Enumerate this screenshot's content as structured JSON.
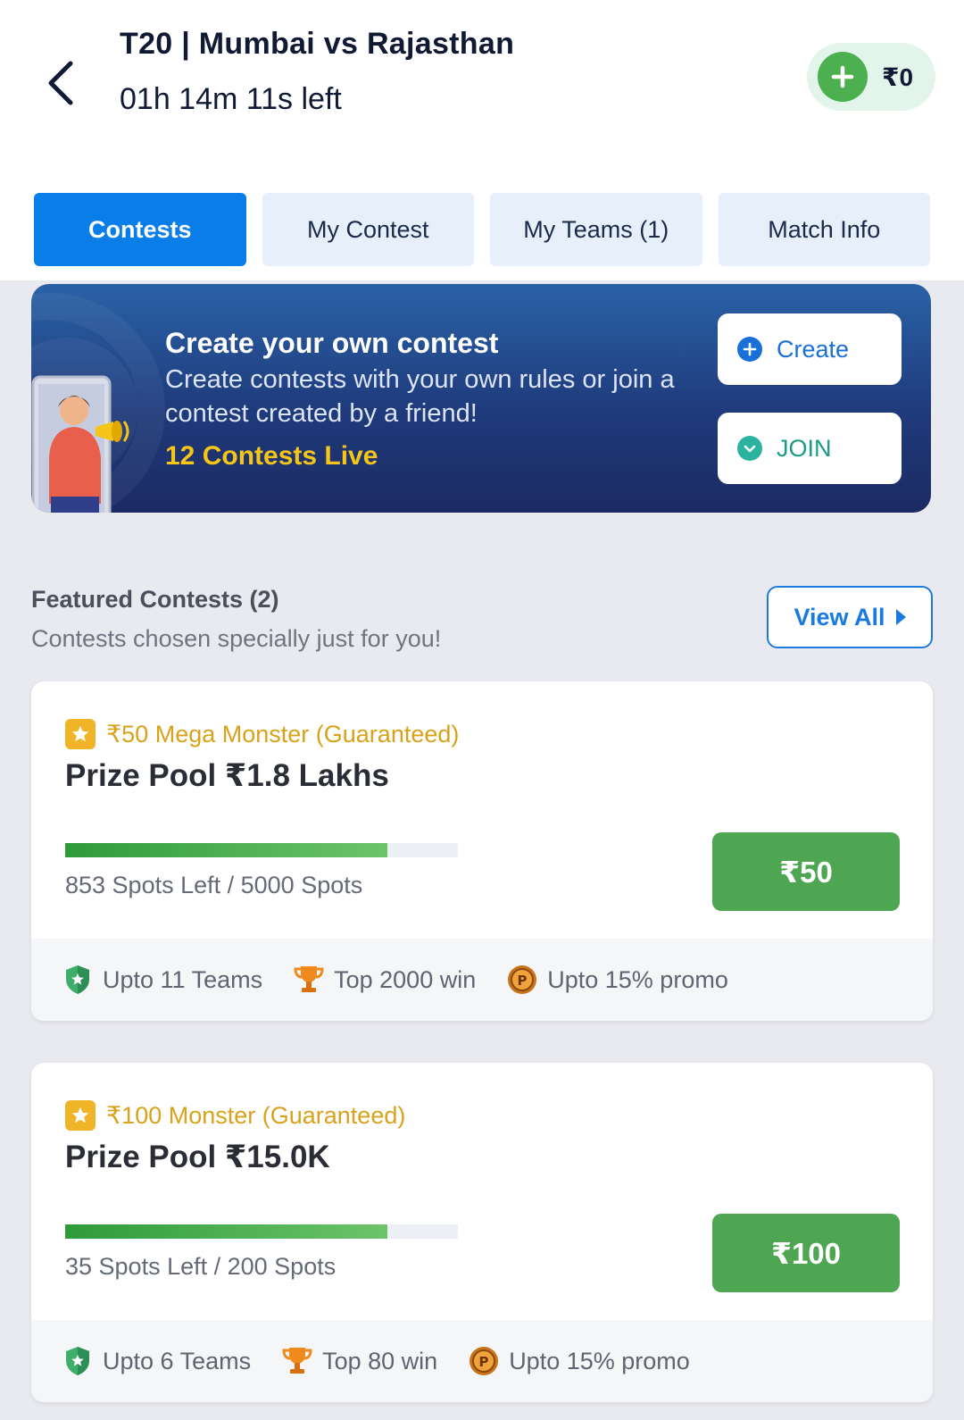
{
  "header": {
    "title": "T20 | Mumbai vs Rajasthan",
    "timer": "01h 14m 11s left",
    "wallet_amount": "₹0"
  },
  "tabs": [
    {
      "label": "Contests",
      "active": true
    },
    {
      "label": "My Contest",
      "active": false
    },
    {
      "label": "My Teams (1)",
      "active": false
    },
    {
      "label": "Match Info",
      "active": false
    }
  ],
  "banner": {
    "title": "Create your own contest",
    "description": "Create contests with your own rules or join a contest created by a friend!",
    "live": "12 Contests Live",
    "create_label": "Create",
    "join_label": "JOIN"
  },
  "featured": {
    "title": "Featured Contests (2)",
    "subtitle": "Contests chosen specially just for you!",
    "view_all": "View All"
  },
  "contests": [
    {
      "name": "₹50 Mega Monster (Guaranteed)",
      "prize": "Prize Pool ₹1.8 Lakhs",
      "spots": "853 Spots Left / 5000 Spots",
      "fill_fraction": 0.82,
      "fee": "₹50",
      "teams": "Upto 11 Teams",
      "winners": "Top 2000 win",
      "promo": "Upto 15% promo"
    },
    {
      "name": "₹100 Monster (Guaranteed)",
      "prize": "Prize Pool ₹15.0K",
      "spots": "35 Spots Left / 200 Spots",
      "fill_fraction": 0.82,
      "fee": "₹100",
      "teams": "Upto 6 Teams",
      "winners": "Top 80 win",
      "promo": "Upto 15% promo"
    }
  ],
  "colors": {
    "accent": "#0a7ee8",
    "join_green": "#4ea652",
    "gold": "#d9a21b",
    "banner_live": "#f5c518"
  }
}
